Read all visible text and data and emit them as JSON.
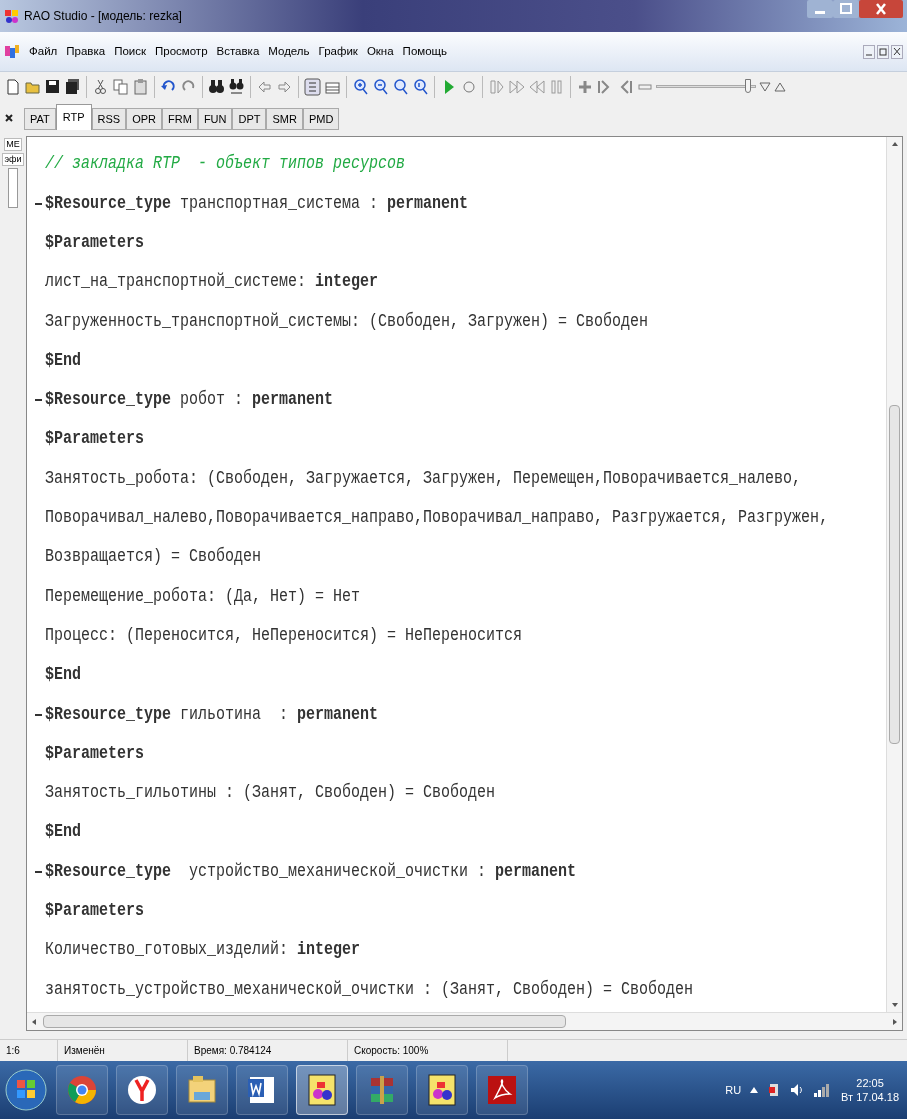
{
  "window": {
    "title": "RAO Studio - [модель: rezka]"
  },
  "menu": [
    "Файл",
    "Правка",
    "Поиск",
    "Просмотр",
    "Вставка",
    "Модель",
    "График",
    "Окна",
    "Помощь"
  ],
  "toolbar": {
    "slider": {
      "level": 0.92
    }
  },
  "side_panel": {
    "labels": [
      "МЕ",
      "эфи"
    ]
  },
  "tabs": [
    {
      "label": "PAT",
      "selected": false
    },
    {
      "label": "RTP",
      "selected": true
    },
    {
      "label": "RSS",
      "selected": false
    },
    {
      "label": "OPR",
      "selected": false
    },
    {
      "label": "FRM",
      "selected": false
    },
    {
      "label": "FUN",
      "selected": false
    },
    {
      "label": "DPT",
      "selected": false
    },
    {
      "label": "SMR",
      "selected": false
    },
    {
      "label": "PMD",
      "selected": false
    }
  ],
  "editor": {
    "lines": [
      {
        "kind": "comment",
        "fold": false,
        "text": "// закладка RTP  - объект типов ресурсов"
      },
      {
        "kind": "code",
        "fold": true,
        "text": "**$Resource_type** транспортная_система : **permanent**"
      },
      {
        "kind": "code",
        "fold": false,
        "text": "**$Parameters**"
      },
      {
        "kind": "code",
        "fold": false,
        "text": "лист_на_транспортной_системе: **integer**"
      },
      {
        "kind": "code",
        "fold": false,
        "text": "Загруженность_транспортной_системы: (Свободен, Загружен) = Свободен"
      },
      {
        "kind": "code",
        "fold": false,
        "text": "**$End**"
      },
      {
        "kind": "code",
        "fold": true,
        "text": "**$Resource_type** робот : **permanent**"
      },
      {
        "kind": "code",
        "fold": false,
        "text": "**$Parameters**"
      },
      {
        "kind": "code",
        "fold": false,
        "text": "Занятость_робота: (Свободен, Загружается, Загружен, Перемещен,Поворачивается_налево,"
      },
      {
        "kind": "code",
        "fold": false,
        "text": "Поворачивал_налево,Поворачивается_направо,Поворачивал_направо, Разгружается, Разгружен,"
      },
      {
        "kind": "code",
        "fold": false,
        "text": "Возвращается) = Свободен"
      },
      {
        "kind": "code",
        "fold": false,
        "text": "Перемещение_робота: (Да, Нет) = Нет"
      },
      {
        "kind": "code",
        "fold": false,
        "text": "Процесс: (Переносится, НеПереносится) = НеПереносится"
      },
      {
        "kind": "code",
        "fold": false,
        "text": "**$End**"
      },
      {
        "kind": "code",
        "fold": true,
        "text": "**$Resource_type** гильотина  : **permanent**"
      },
      {
        "kind": "code",
        "fold": false,
        "text": "**$Parameters**"
      },
      {
        "kind": "code",
        "fold": false,
        "text": "Занятость_гильотины : (Занят, Свободен) = Свободен"
      },
      {
        "kind": "code",
        "fold": false,
        "text": "**$End**"
      },
      {
        "kind": "code",
        "fold": true,
        "text": "**$Resource_type**  устройство_механической_очистки : **permanent**"
      },
      {
        "kind": "code",
        "fold": false,
        "text": "**$Parameters**"
      },
      {
        "kind": "code",
        "fold": false,
        "text": "Количество_готовых_изделий: **integer**"
      },
      {
        "kind": "code",
        "fold": false,
        "text": "занятость_устройство_механической_очистки : (Занят, Свободен) = Свободен"
      }
    ]
  },
  "status_bar": [
    "1:6",
    "Изменён",
    "Время: 0.784124",
    "Скорость: 100%"
  ],
  "taskbar": {
    "apps": [
      {
        "kind": "chrome",
        "selected": false
      },
      {
        "kind": "yandex",
        "selected": false
      },
      {
        "kind": "folder",
        "selected": false
      },
      {
        "kind": "word",
        "selected": false
      },
      {
        "kind": "rao",
        "selected": true
      },
      {
        "kind": "archive",
        "selected": false
      },
      {
        "kind": "rao",
        "selected": false
      },
      {
        "kind": "pdf",
        "selected": false
      }
    ],
    "language": "RU",
    "time": "22:05",
    "date": "Вт 17.04.18"
  }
}
